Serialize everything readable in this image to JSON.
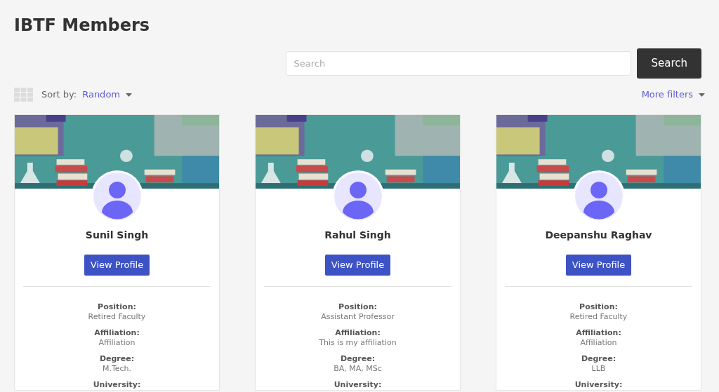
{
  "page_title": "IBTF Members",
  "search": {
    "placeholder": "Search",
    "button": "Search"
  },
  "sort": {
    "label": "Sort by:",
    "value": "Random"
  },
  "more_filters": "More filters",
  "members": [
    {
      "name": "Sunil Singh",
      "button": "View Profile",
      "fields": [
        {
          "label": "Position:",
          "value": "Retired Faculty"
        },
        {
          "label": "Affiliation:",
          "value": "Affiliation"
        },
        {
          "label": "Degree:",
          "value": "M.Tech."
        },
        {
          "label": "University:"
        }
      ]
    },
    {
      "name": "Rahul Singh",
      "button": "View Profile",
      "fields": [
        {
          "label": "Position:",
          "value": "Assistant Professor"
        },
        {
          "label": "Affiliation:",
          "value": "This is my affiliation"
        },
        {
          "label": "Degree:",
          "value": "BA, MA, MSc"
        },
        {
          "label": "University:"
        }
      ]
    },
    {
      "name": "Deepanshu Raghav",
      "button": "View Profile",
      "fields": [
        {
          "label": "Position:",
          "value": "Retired Faculty"
        },
        {
          "label": "Affiliation:",
          "value": "Affiliation"
        },
        {
          "label": "Degree:",
          "value": "LLB"
        },
        {
          "label": "University:"
        }
      ]
    }
  ]
}
